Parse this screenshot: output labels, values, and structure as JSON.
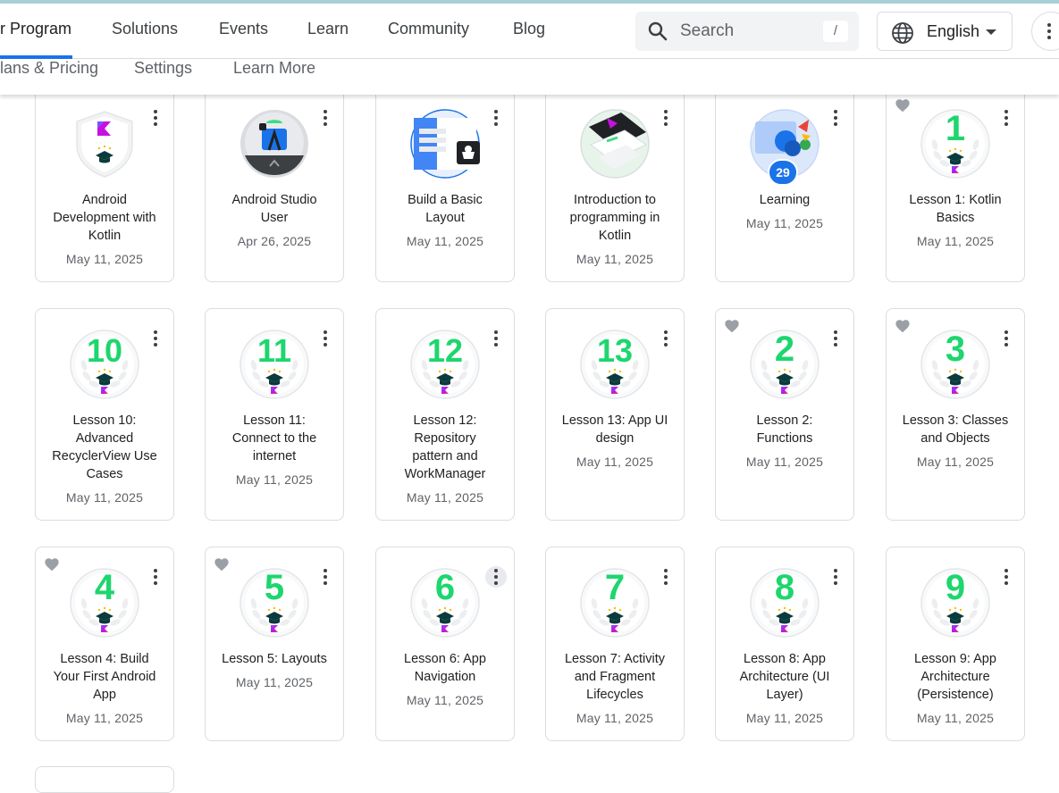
{
  "nav": {
    "items": [
      "r Program",
      "Solutions",
      "Events",
      "Learn",
      "Community",
      "Blog"
    ]
  },
  "search": {
    "placeholder": "Search",
    "shortcut": "/"
  },
  "language": {
    "label": "English"
  },
  "subnav": {
    "items": [
      "lans & Pricing",
      "Settings",
      "Learn More"
    ]
  },
  "badges": [
    {
      "title_lines": [
        "Android",
        "Development with",
        "Kotlin"
      ],
      "date": "May 11, 2025",
      "art": "shield"
    },
    {
      "title_lines": [
        "Android Studio",
        "User"
      ],
      "date": "Apr 26, 2025",
      "art": "studio"
    },
    {
      "title_lines": [
        "Build a Basic",
        "Layout"
      ],
      "date": "May 11, 2025",
      "art": "layout"
    },
    {
      "title_lines": [
        "Introduction to",
        "programming in",
        "Kotlin"
      ],
      "date": "May 11, 2025",
      "art": "intro"
    },
    {
      "title_lines": [
        "Learning"
      ],
      "date": "May 11, 2025",
      "art": "learning",
      "count": "29"
    },
    {
      "title_lines": [
        "Lesson 1: Kotlin",
        "Basics"
      ],
      "date": "May 11, 2025",
      "number": "1",
      "liked": true
    },
    {
      "title_lines": [
        "Lesson 10:",
        "Advanced",
        "RecyclerView Use",
        "Cases"
      ],
      "date": "May 11, 2025",
      "number": "10"
    },
    {
      "title_lines": [
        "Lesson 11:",
        "Connect to the",
        "internet"
      ],
      "date": "May 11, 2025",
      "number": "11"
    },
    {
      "title_lines": [
        "Lesson 12:",
        "Repository",
        "pattern and",
        "WorkManager"
      ],
      "date": "May 11, 2025",
      "number": "12"
    },
    {
      "title_lines": [
        "Lesson 13: App UI",
        "design"
      ],
      "date": "May 11, 2025",
      "number": "13"
    },
    {
      "title_lines": [
        "Lesson 2:",
        "Functions"
      ],
      "date": "May 11, 2025",
      "number": "2",
      "liked": true
    },
    {
      "title_lines": [
        "Lesson 3: Classes",
        "and Objects"
      ],
      "date": "May 11, 2025",
      "number": "3",
      "liked": true
    },
    {
      "title_lines": [
        "Lesson 4: Build",
        "Your First Android",
        "App"
      ],
      "date": "May 11, 2025",
      "number": "4",
      "liked": true
    },
    {
      "title_lines": [
        "Lesson 5: Layouts"
      ],
      "date": "May 11, 2025",
      "number": "5",
      "liked": true
    },
    {
      "title_lines": [
        "Lesson 6: App",
        "Navigation"
      ],
      "date": "May 11, 2025",
      "number": "6",
      "menu_hover": true
    },
    {
      "title_lines": [
        "Lesson 7: Activity",
        "and Fragment",
        "Lifecycles"
      ],
      "date": "May 11, 2025",
      "number": "7"
    },
    {
      "title_lines": [
        "Lesson 8: App",
        "Architecture (UI",
        "Layer)"
      ],
      "date": "May 11, 2025",
      "number": "8"
    },
    {
      "title_lines": [
        "Lesson 9: App",
        "Architecture",
        "(Persistence)"
      ],
      "date": "May 11, 2025",
      "number": "9"
    }
  ],
  "colors": {
    "accent": "#1a73e8",
    "lesson_number": "#1dd66e",
    "heart": "#9aa0a6",
    "kotlin_gradient": [
      "#7f52ff",
      "#e44857"
    ]
  }
}
